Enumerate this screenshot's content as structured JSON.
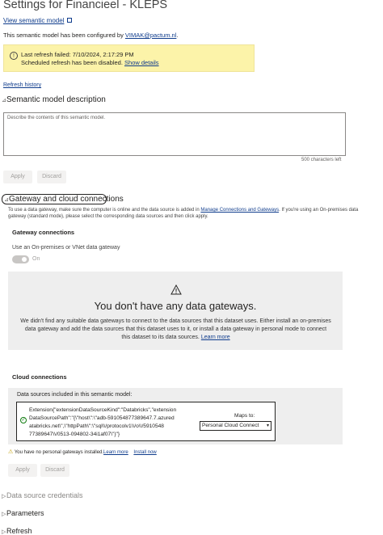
{
  "page": {
    "title": "Settings for Financieel - KLEPS",
    "view_model_link": "View semantic model",
    "configured_prefix": "This semantic model has been configured by ",
    "configured_by": "VIMAK@pactum.nl",
    "configured_suffix": "."
  },
  "alert": {
    "line1": "Last refresh failed: 7/10/2024, 2:17:29 PM",
    "line2": "Scheduled refresh has been disabled.",
    "show_details": "Show details"
  },
  "refresh_history": "Refresh history",
  "description_section": {
    "heading": "Semantic model description",
    "placeholder": "Describe the contents of this semantic model.",
    "chars_left": "500 characters left",
    "apply": "Apply",
    "discard": "Discard"
  },
  "gateway_section": {
    "heading": "Gateway and cloud connections",
    "desc_part1": "To use a data gateway, make sure the computer is online and the data source is added in ",
    "desc_link": "Manage Connections and Gateways",
    "desc_part2": ". If you're using an On-premises data gateway (standard mode), please select the corresponding data sources and then click apply.",
    "gateway_connections": "Gateway connections",
    "use_gateway_label": "Use an On-premises or VNet data gateway",
    "toggle_label": "On",
    "empty_title": "You don't have any data gateways.",
    "empty_body": "We didn't find any suitable data gateways to connect to the data sources that this dataset uses. Either install an on-premises data gateway and add the data sources that this dataset uses to it, or install a data gateway in personal mode to connect this dataset to its data sources.",
    "learn_more": "Learn more",
    "cloud_connections": "Cloud connections",
    "ds_included": "Data sources included in this semantic model:",
    "ds_lines": [
      "Extension{\"extensionDataSourceKind\":\"Databricks\",\"extension",
      "DataSourcePath\":\"{\\\"host\\\":\\\"adb-591054877389647.7.azured",
      "atabricks.net\\\",\\\"httpPath\\\":\\\"sql\\\\/protocolv1\\\\/o\\\\/5910548",
      "77389647\\\\/0513-094802-34i1af07\\\"}\"}"
    ],
    "maps_to": "Maps to:",
    "maps_value": "Personal Cloud Connect",
    "no_personal": "You have no personal gateways installed.",
    "learn_more2": "Learn more",
    "install_now": "Install now",
    "apply": "Apply",
    "discard": "Discard"
  },
  "collapsed_sections": {
    "data_source_credentials": "Data source credentials",
    "parameters": "Parameters",
    "refresh": "Refresh"
  }
}
